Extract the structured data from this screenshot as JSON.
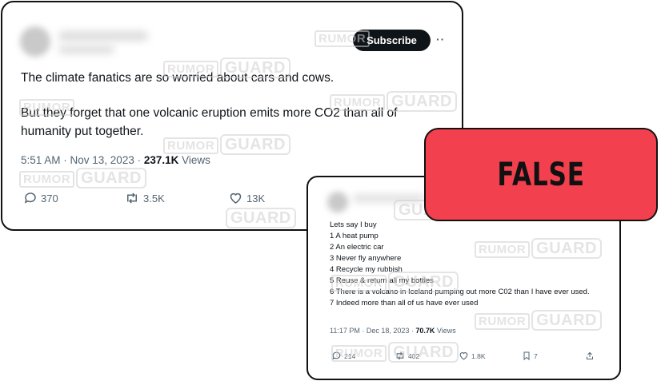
{
  "tweet1": {
    "subscribe_label": "Subscribe",
    "text_line1": "The climate fanatics are so worried about cars and cows.",
    "text_line2": "But they forget that one volcanic eruption emits more CO2 than all of",
    "text_line3": "humanity put together.",
    "timestamp": "5:51 AM · Nov 13, 2023 · ",
    "views_count": "237.1K",
    "views_label": " Views",
    "replies": "370",
    "reposts": "3.5K",
    "likes": "13K"
  },
  "tweet2": {
    "intro": "Lets say I buy",
    "items": [
      "1 A heat pump",
      "2 An electric car",
      "3 Never fly anywhere",
      "4 Recycle my rubbish",
      "5 Reuse & return all my bottles",
      "6 There is a volcano in Iceland pumping out more C02 than I have ever used.",
      "7 Indeed more than all of us have ever used"
    ],
    "timestamp": "11:17 PM · Dec 18, 2023 · ",
    "views_count": "70.7K",
    "views_label": " Views",
    "replies": "214",
    "reposts": "402",
    "likes": "1.8K",
    "bookmarks": "7"
  },
  "verdict": {
    "label": "FALSE",
    "color": "#f2404f"
  },
  "watermark": {
    "rumor": "RUMOR",
    "guard": "GUARD"
  },
  "icons": [
    "reply-icon",
    "repost-icon",
    "like-icon",
    "bookmark-icon",
    "share-icon",
    "more-icon"
  ]
}
